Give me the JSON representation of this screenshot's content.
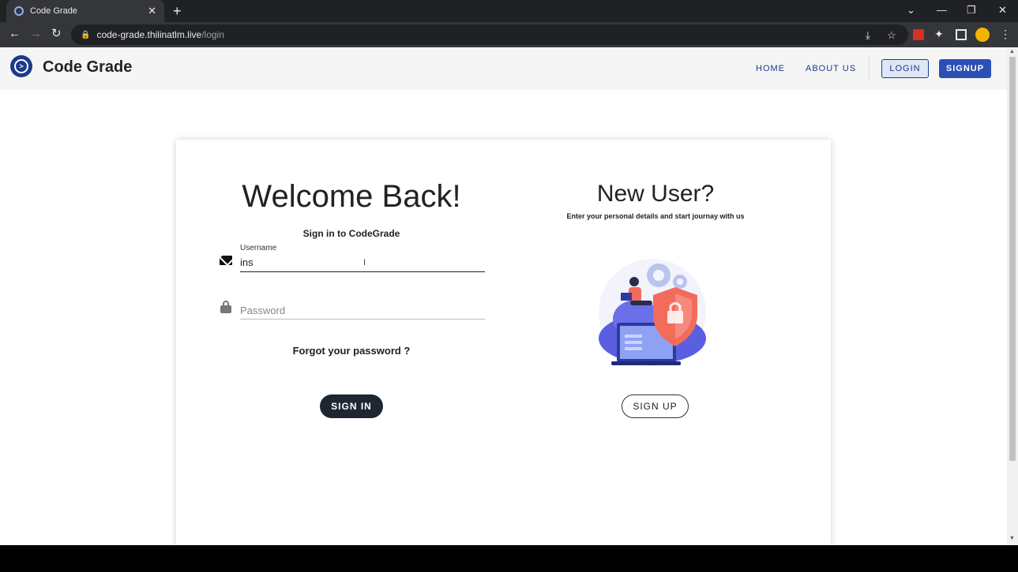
{
  "browser": {
    "tab_title": "Code Grade",
    "new_tab": "+",
    "url_host": "code-grade.thilinatlm.live",
    "url_path": "/login"
  },
  "appbar": {
    "brand": "Code Grade",
    "nav": [
      "HOME",
      "ABOUT US"
    ],
    "login_label": "LOGIN",
    "signup_label": "SIGNUP"
  },
  "signin": {
    "title": "Welcome Back!",
    "subtitle": "Sign in to CodeGrade",
    "username_label": "Username",
    "username_value": "ins",
    "password_placeholder": "Password",
    "forgot": "Forgot your password ?",
    "button": "SIGN IN"
  },
  "newuser": {
    "title": "New User?",
    "subtitle": "Enter your personal details and start journay with us",
    "button": "SIGN UP"
  },
  "colors": {
    "brand": "#1a3b8c",
    "signup_btn": "#2b4fb5",
    "signin_btn": "#1e2533"
  }
}
